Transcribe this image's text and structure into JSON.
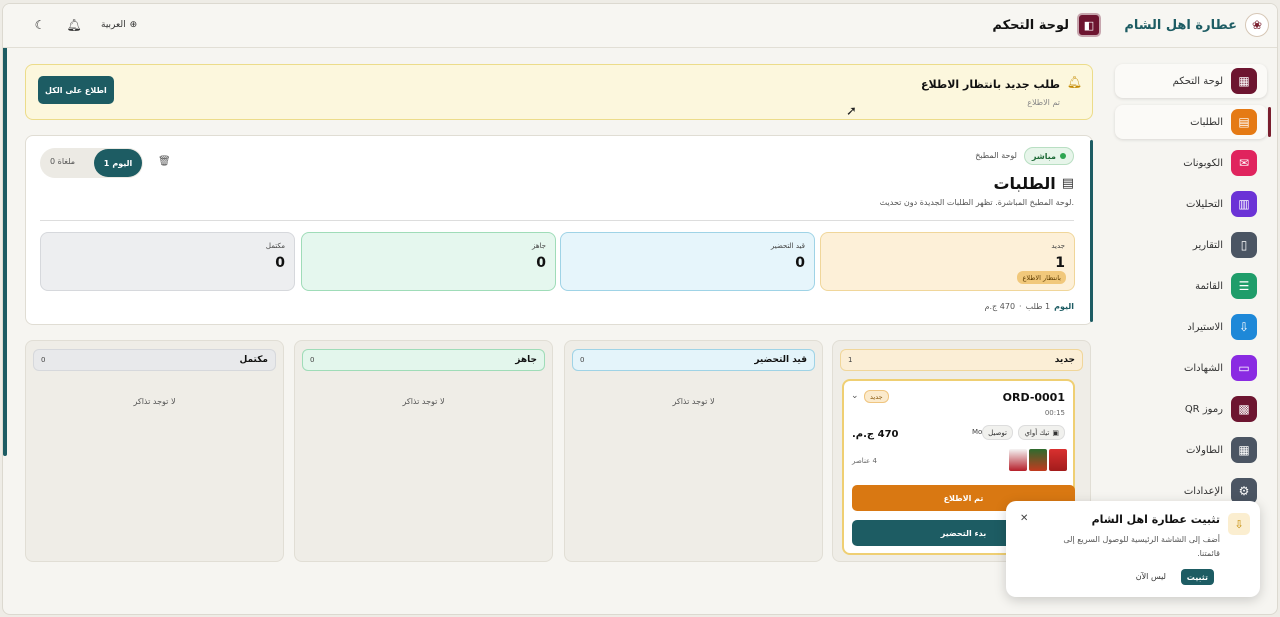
{
  "brand": {
    "name": "عطارة اهل الشام"
  },
  "header": {
    "page_title": "لوحة التحكم",
    "language": "العربية"
  },
  "sidebar": {
    "items": [
      {
        "label": "لوحة التحكم",
        "icon": "grid-icon",
        "color": "#6d1530",
        "glyph": "▦"
      },
      {
        "label": "الطلبات",
        "icon": "clipboard-icon",
        "color": "#e57a14",
        "glyph": "▤"
      },
      {
        "label": "الكوبونات",
        "icon": "ticket-icon",
        "color": "#e0245e",
        "glyph": "✉"
      },
      {
        "label": "التحليلات",
        "icon": "bar-chart-icon",
        "color": "#6b33d6",
        "glyph": "▥"
      },
      {
        "label": "التقارير",
        "icon": "file-icon",
        "color": "#4b5563",
        "glyph": "▯"
      },
      {
        "label": "القائمة",
        "icon": "list-icon",
        "color": "#1f9d6a",
        "glyph": "☰"
      },
      {
        "label": "الاستيراد",
        "icon": "import-icon",
        "color": "#1e88d8",
        "glyph": "⇩"
      },
      {
        "label": "الشهادات",
        "icon": "chat-icon",
        "color": "#8a2be2",
        "glyph": "▭"
      },
      {
        "label": "رموز QR",
        "icon": "qr-icon",
        "color": "#6d1530",
        "glyph": "▩"
      },
      {
        "label": "الطاولات",
        "icon": "table-icon",
        "color": "#4b5563",
        "glyph": "▦"
      },
      {
        "label": "الإعدادات",
        "icon": "gear-icon",
        "color": "#4b5563",
        "glyph": "⚙"
      }
    ]
  },
  "alert": {
    "title": "طلب جديد بانتظار الاطلاع",
    "subtitle": "تم الاطلاع",
    "button": "اطلاع على الكل"
  },
  "orders_panel": {
    "live_label": "مباشر",
    "kitchen_label": "لوحة المطبخ",
    "today_label": "اليوم",
    "today_count": "1",
    "cancelled_label": "ملغاة",
    "cancelled_count": "0",
    "title": "الطلبات",
    "subtitle": "لوحة المطبخ المباشرة. تظهر الطلبات الجديدة دون تحديث.",
    "stats": [
      {
        "label": "جديد",
        "value": "1",
        "badge": "بانتظار الاطلاع"
      },
      {
        "label": "قيد التحضير",
        "value": "0"
      },
      {
        "label": "جاهز",
        "value": "0"
      },
      {
        "label": "مكتمل",
        "value": "0"
      }
    ],
    "summary": {
      "today": "اليوم",
      "count": "1 طلب",
      "sep": "·",
      "total": "470 ج.م"
    }
  },
  "columns": [
    {
      "name": "جديد",
      "count": "1"
    },
    {
      "name": "قيد التحضير",
      "count": "0",
      "empty": "لا توجد تذاكر"
    },
    {
      "name": "جاهز",
      "count": "0",
      "empty": "لا توجد تذاكر"
    },
    {
      "name": "مكتمل",
      "count": "0",
      "empty": "لا توجد تذاكر"
    }
  ],
  "order": {
    "id": "ORD-0001",
    "time": "00:15",
    "status": "جديد",
    "tag_takeaway": "تيك أواي",
    "tag_delivery": "توصيل",
    "customer": "Mo",
    "price": "470 ج.م.",
    "items": "4 عناصر",
    "btn_ack": "تم الاطلاع",
    "btn_start": "بدء التحضير"
  },
  "toast": {
    "title": "تثبيت عطارة اهل الشام",
    "message": "أضف إلى الشاشة الرئيسية للوصول السريع إلى قائمتنا.",
    "install": "تثبيت",
    "later": "ليس الآن"
  },
  "colors": {
    "accent": "#1d5c63",
    "brand": "#6d1530",
    "new": "#fdf0d8",
    "prep": "#e6f5fb",
    "ready": "#e5f7ee",
    "done": "#edeef0",
    "orange": "#d97812"
  }
}
